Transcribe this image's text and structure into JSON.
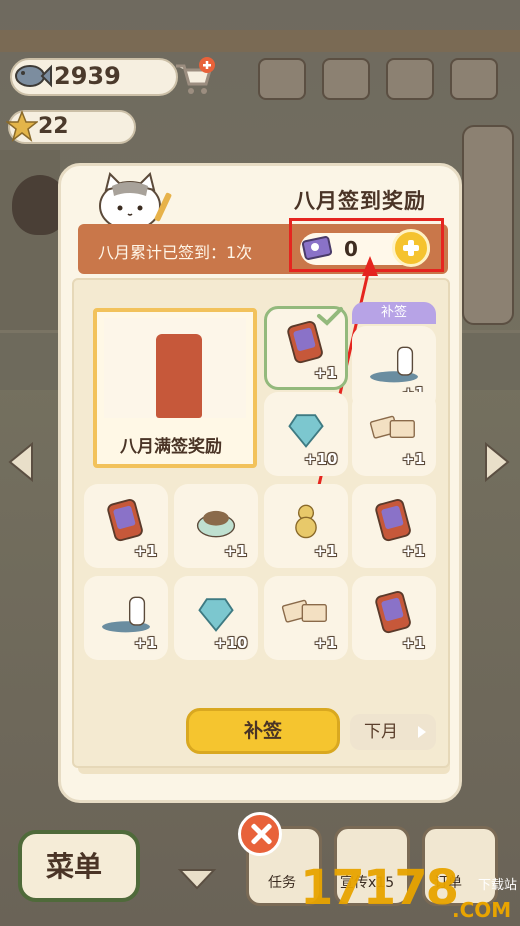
{
  "currency": {
    "fish": "2939",
    "stars": "22"
  },
  "modal": {
    "title": "八月签到奖励",
    "signed_text": "八月累计已签到：1次",
    "tickets": "0",
    "big_reward_label": "八月满签奖励",
    "makeup_tag": "补签",
    "makeup_button": "补签",
    "next_month_button": "下月"
  },
  "cells": [
    {
      "item": "tablet-icon",
      "value": "+1",
      "state": "claimed"
    },
    {
      "item": "cat-on-mat-icon",
      "value": "+1",
      "state": "makeup"
    },
    {
      "item": "diamond-icon",
      "value": "+10",
      "state": "locked"
    },
    {
      "item": "tickets-icon",
      "value": "+1",
      "state": "locked"
    },
    {
      "item": "tablet-icon",
      "value": "+1",
      "state": "locked"
    },
    {
      "item": "food-bowl-icon",
      "value": "+1",
      "state": "locked"
    },
    {
      "item": "gourd-icon",
      "value": "+1",
      "state": "locked"
    },
    {
      "item": "tablet-icon",
      "value": "+1",
      "state": "locked"
    },
    {
      "item": "cat-on-mat-icon",
      "value": "+1",
      "state": "locked"
    },
    {
      "item": "diamond-icon",
      "value": "+10",
      "state": "locked"
    },
    {
      "item": "tickets-icon",
      "value": "+1",
      "state": "locked"
    },
    {
      "item": "tablet-icon",
      "value": "+1",
      "state": "locked"
    }
  ],
  "hud": {
    "menu": "菜单",
    "tasks": "任务",
    "promo": "宣传x15",
    "orders": "订单"
  },
  "watermark": {
    "main": "17178",
    "sub": "下载站",
    "com": ".COM"
  },
  "colors": {
    "accent": "#f5c32f",
    "banner": "#c9774a",
    "highlight": "#e5251f",
    "makeup_tag": "#b7a3e6"
  }
}
